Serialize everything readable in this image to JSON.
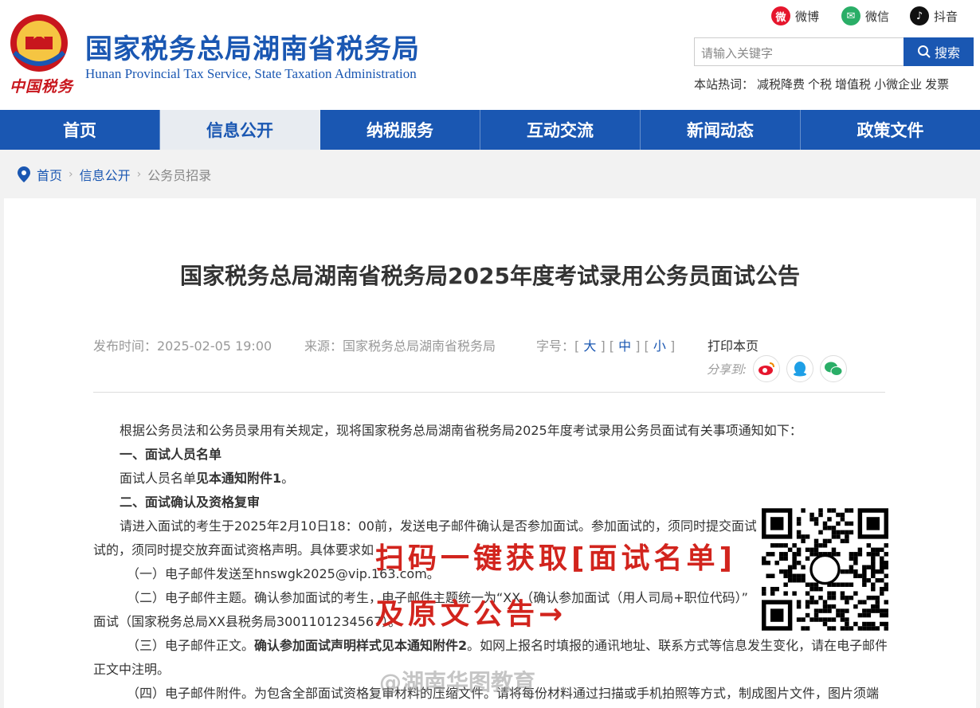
{
  "header": {
    "seal_text": "中国税务",
    "title": "国家税务总局湖南省税务局",
    "subtitle": "Hunan Provincial  Tax Service,  State Taxation Administration",
    "social": [
      {
        "label": "微博",
        "icon": "weibo-icon",
        "color": "#e6162d"
      },
      {
        "label": "微信",
        "icon": "wechat-icon",
        "color": "#2aae67"
      },
      {
        "label": "抖音",
        "icon": "douyin-icon",
        "color": "#111111"
      }
    ],
    "search": {
      "placeholder": "请输入关键字",
      "button": "搜索"
    },
    "hot": {
      "label": "本站热词：",
      "words": [
        "减税降费",
        "个税",
        "增值税",
        "小微企业",
        "发票"
      ]
    }
  },
  "nav": [
    "首页",
    "信息公开",
    "纳税服务",
    "互动交流",
    "新闻动态",
    "政策文件"
  ],
  "breadcrumb": {
    "home": "首页",
    "level2": "信息公开",
    "current": "公务员招录",
    "sep": "›"
  },
  "article": {
    "title": "国家税务总局湖南省税务局2025年度考试录用公务员面试公告",
    "date": "发布时间：2025-02-05 19:00",
    "source": "来源：国家税务总局湖南省税务局",
    "font_label": "字号：",
    "font_big": "大",
    "font_mid": "中",
    "font_small": "小",
    "print": "打印本页",
    "share_label": "分享到:",
    "paragraphs": {
      "p1": "根据公务员法和公务员录用有关规定，现将国家税务总局湖南省税务局2025年度考试录用公务员面试有关事项通知如下：",
      "h1": "一、面试人员名单",
      "p2a": "面试人员名单",
      "p2b": "见本通知附件1",
      "p2c": "。",
      "h2": "二、面试确认及资格复审",
      "p3": "请进入面试的考生于2025年2月10日18：00前，发送电子邮件确认是否参加面试。参加面试的，须同时提交面试资",
      "p4": "试的，须同时提交放弃面试资格声明。具体要求如",
      "p5": "（一）电子邮件发送至hnswgk2025@vip.163.com。",
      "p6": "（二）电子邮件主题。确认参加面试的考生，电子邮件主题统一为“XX（确认参加面试（用人司局+职位代码）”",
      "p7": "面试（国家税务总局XX县税务局3001101234567）。",
      "p8a": "（三）电子邮件正文。",
      "p8b": "确认参加面试声明样式见本通知附件2",
      "p8c": "。如网上报名时填报的通讯地址、联系方式等信息发生变化，请在电子邮件",
      "p9": "正文中注明。",
      "p10": "（四）电子邮件附件。为包含全部面试资格复审材料的压缩文件。请将每份材料通过扫描或手机拍照等方式，制成图片文件，图片须端"
    }
  },
  "overlay": {
    "line1": "扫码一键获取[面试名单]",
    "line2": "及原文公告→",
    "watermark": "@湖南华图教育"
  },
  "colors": {
    "brand_blue": "#1a57b2",
    "accent_red": "#d2241d"
  }
}
